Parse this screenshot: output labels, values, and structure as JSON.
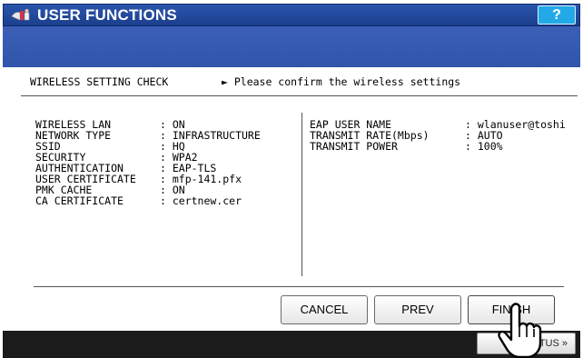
{
  "title_bar": {
    "title": "USER FUNCTIONS",
    "help_label": "?"
  },
  "check": {
    "heading": "WIRELESS SETTING CHECK",
    "instruction": "► Please confirm the wireless settings",
    "left_settings": [
      {
        "label": "WIRELESS LAN",
        "value": ": ON"
      },
      {
        "label": "NETWORK TYPE",
        "value": ": INFRASTRUCTURE"
      },
      {
        "label": "SSID",
        "value": ": HQ"
      },
      {
        "label": "SECURITY",
        "value": ": WPA2"
      },
      {
        "label": "AUTHENTICATION",
        "value": ": EAP-TLS"
      },
      {
        "label": "USER CERTIFICATE",
        "value": ": mfp-141.pfx"
      },
      {
        "label": "PMK CACHE",
        "value": ": ON"
      },
      {
        "label": "CA CERTIFICATE",
        "value": ": certnew.cer"
      }
    ],
    "right_settings": [
      {
        "label": "EAP USER NAME",
        "value": ": wlanuser@toshi"
      },
      {
        "label": "TRANSMIT RATE(Mbps)",
        "value": ": AUTO"
      },
      {
        "label": "TRANSMIT POWER",
        "value": ": 100%"
      }
    ]
  },
  "buttons": {
    "cancel": "CANCEL",
    "prev": "PREV",
    "finish": "FINISH"
  },
  "footer": {
    "job_status_label": "JOB STATUS »",
    "job_status_visible": "TUS »"
  },
  "colors": {
    "title_bar": "#1f4596",
    "band": "#3358b0",
    "help_button": "#23a9e7",
    "footer": "#1b1b1b"
  }
}
